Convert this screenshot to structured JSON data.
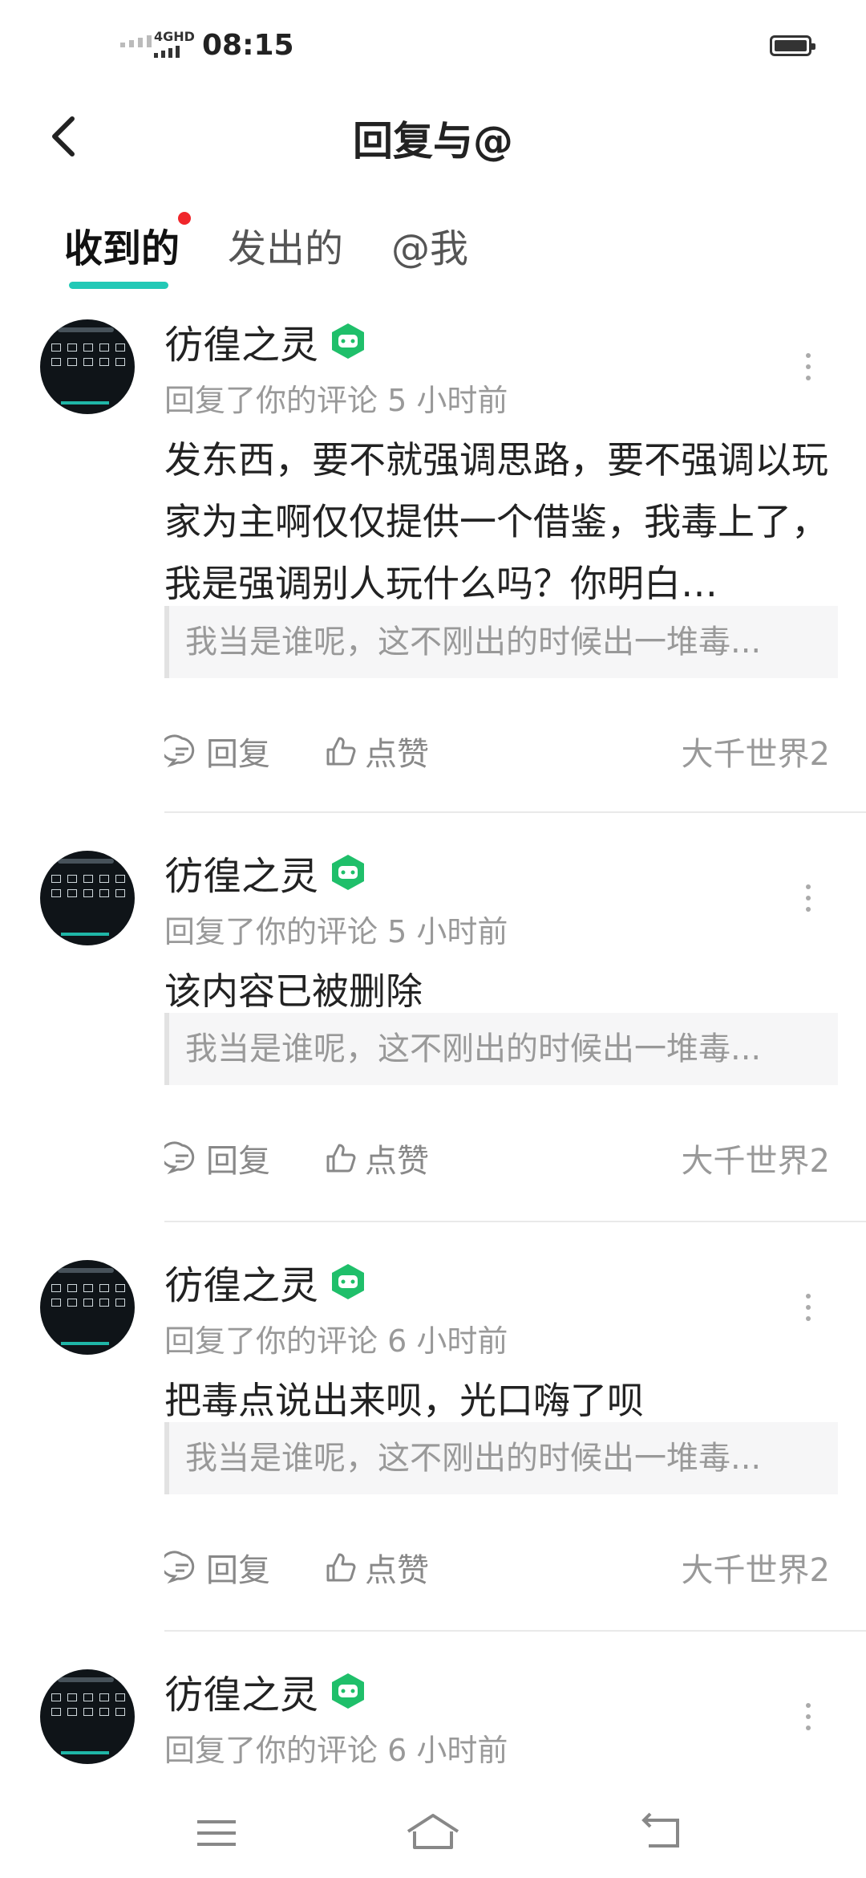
{
  "status": {
    "network": "4GHD",
    "time": "08:15"
  },
  "header": {
    "title": "回复与@",
    "back_icon": "chevron-left-icon"
  },
  "tabs": [
    {
      "label": "收到的",
      "active": true,
      "has_dot": true
    },
    {
      "label": "发出的",
      "active": false
    },
    {
      "label": "@我",
      "active": false
    }
  ],
  "colors": {
    "accent": "#22c9b6",
    "badge_green": "#1fbf6a",
    "dot_red": "#f0262b"
  },
  "items": [
    {
      "user": "彷徨之灵",
      "meta": "回复了你的评论 5 小时前",
      "content": "发东西，要不就强调思路，要不强调以玩家为主啊仅仅提供一个借鉴，我毒上了，我是强调别人玩什么吗？你明白…",
      "quote": "我当是谁呢，这不刚出的时候出一堆毒...",
      "reply_label": "回复",
      "like_label": "点赞",
      "source": "大千世界2"
    },
    {
      "user": "彷徨之灵",
      "meta": "回复了你的评论 5 小时前",
      "content": "该内容已被删除",
      "quote": "我当是谁呢，这不刚出的时候出一堆毒...",
      "reply_label": "回复",
      "like_label": "点赞",
      "source": "大千世界2"
    },
    {
      "user": "彷徨之灵",
      "meta": "回复了你的评论 6 小时前",
      "content": "把毒点说出来呗，光口嗨了呗",
      "quote": "我当是谁呢，这不刚出的时候出一堆毒...",
      "reply_label": "回复",
      "like_label": "点赞",
      "source": "大千世界2"
    },
    {
      "user": "彷徨之灵",
      "meta": "回复了你的评论 6 小时前"
    }
  ]
}
